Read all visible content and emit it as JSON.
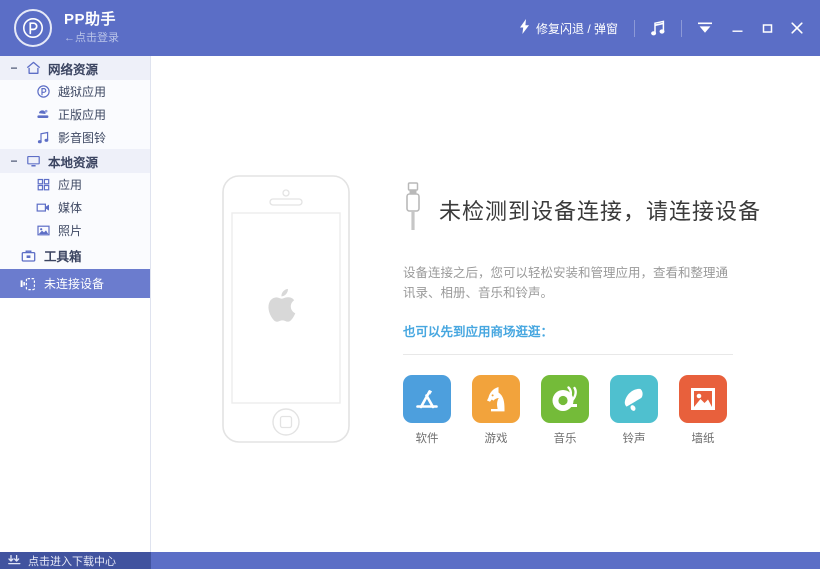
{
  "header": {
    "brand_mark": "P",
    "title": "PP助手",
    "subtitle": "←点击登录",
    "fix_label": "修复闪退 / 弹窗",
    "bolt_icon": "lightning-bolt-icon",
    "music_icon": "music-note-icon",
    "tray_icon": "collapse-to-tray-icon",
    "minimize_label": "—",
    "maximize_label": "□",
    "close_label": "✕"
  },
  "sidebar": {
    "groups": [
      {
        "label": "网络资源",
        "icon": "home-icon",
        "toggle": "−",
        "items": [
          {
            "label": "越狱应用",
            "icon": "pp-circle-icon"
          },
          {
            "label": "正版应用",
            "icon": "genuine-apps-icon"
          },
          {
            "label": "影音图铃",
            "icon": "media-note-icon"
          }
        ]
      },
      {
        "label": "本地资源",
        "icon": "monitor-icon",
        "toggle": "−",
        "items": [
          {
            "label": "应用",
            "icon": "grid-apps-icon"
          },
          {
            "label": "媒体",
            "icon": "video-camera-icon"
          },
          {
            "label": "照片",
            "icon": "photo-icon"
          }
        ]
      }
    ],
    "toolbox": {
      "label": "工具箱",
      "icon": "toolbox-icon"
    },
    "device": {
      "label": "未连接设备",
      "icon": "device-disconnected-icon"
    }
  },
  "main": {
    "phone_icon": "iphone-outline-illustration",
    "apple_logo": "apple-logo-icon",
    "plug_icon": "usb-connector-icon",
    "headline": "未检测到设备连接，请连接设备",
    "description": "设备连接之后，您可以轻松安装和管理应用，查看和整理通讯录、相册、音乐和铃声。",
    "shop_link": "也可以先到应用商场逛逛：",
    "categories": [
      {
        "label": "软件",
        "icon": "app-store-icon",
        "color": "#4d9fdd"
      },
      {
        "label": "游戏",
        "icon": "chess-knight-icon",
        "color": "#f2a33c"
      },
      {
        "label": "音乐",
        "icon": "french-horn-icon",
        "color": "#74bb39"
      },
      {
        "label": "铃声",
        "icon": "bell-icon",
        "color": "#4fc0cf"
      },
      {
        "label": "墙纸",
        "icon": "picture-frame-icon",
        "color": "#e8603c"
      }
    ]
  },
  "statusbar": {
    "download_label": "点击进入下载中心",
    "download_icon": "download-arrows-icon"
  },
  "colors": {
    "header_blue": "#5b6ec6",
    "selected_blue": "#6b7cce",
    "statusbar_dark": "#41539f",
    "link_blue": "#47a7e0",
    "sidebar_bg": "#fafbfe"
  }
}
